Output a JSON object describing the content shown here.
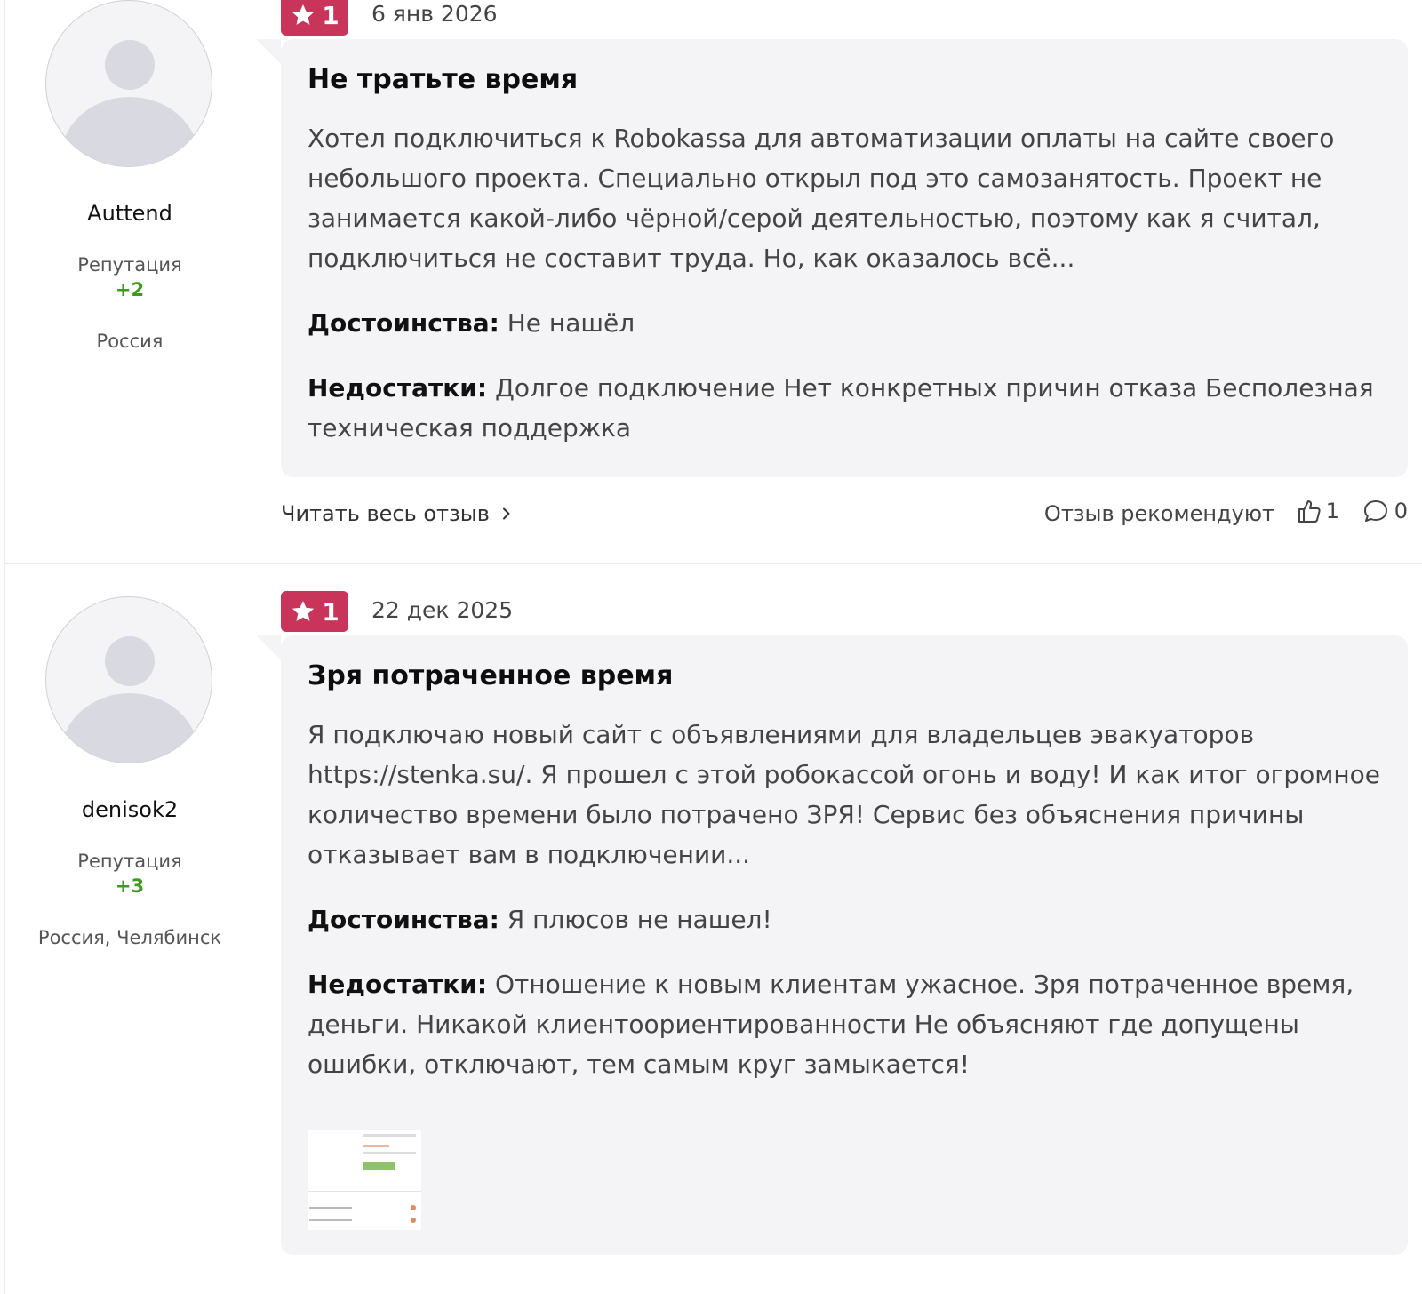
{
  "reviews": [
    {
      "author": {
        "name": "Auttend",
        "reputation_label": "Репутация",
        "reputation": "+2",
        "location": "Россия"
      },
      "rating": "1",
      "date": "6 янв 2026",
      "title": "Не тратьте время",
      "text": "Хотел подключиться к Robokassa для автоматизации оплаты на сайте своего небольшого проекта. Специально открыл под это самозанятость. Проект не занимается какой-либо чёрной/серой деятельностью, поэтому как я считал, подключиться не составит труда. Но, как оказалось всё...",
      "pros_label": "Достоинства:",
      "pros": "Не нашёл",
      "cons_label": "Недостатки:",
      "cons": "Долгое подключение Нет конкретных причин отказа Бесполезная техническая поддержка",
      "read_more": "Читать весь отзыв",
      "recommend_label": "Отзыв рекомендуют",
      "likes": "1",
      "comments": "0"
    },
    {
      "author": {
        "name": "denisok2",
        "reputation_label": "Репутация",
        "reputation": "+3",
        "location": "Россия, Челябинск"
      },
      "rating": "1",
      "date": "22 дек 2025",
      "title": "Зря потраченное время",
      "text": "Я подключаю новый сайт с объявлениями для владельцев эвакуаторов https://stenka.su/. Я прошел с этой робокассой огонь и воду! И как итог огромное количество времени было потрачено ЗРЯ! Сервис без объяснения причины отказывает вам в подключении...",
      "pros_label": "Достоинства:",
      "pros": "Я плюсов не нашел!",
      "cons_label": "Недостатки:",
      "cons": "Отношение к новым клиентам ужасное. Зря потраченное время, деньги. Никакой клиентоориентированности Не объясняют где допущены ошибки, отключают, тем самым круг замыкается!"
    }
  ],
  "colors": {
    "rating_badge": "#c9345a",
    "reputation": "#3c9a1f",
    "bubble": "#f4f4f6"
  },
  "icons": {
    "rating": "star-icon",
    "read_more": "chevron-right-icon",
    "likes": "thumbs-up-icon",
    "comments": "comment-bubble-icon"
  }
}
